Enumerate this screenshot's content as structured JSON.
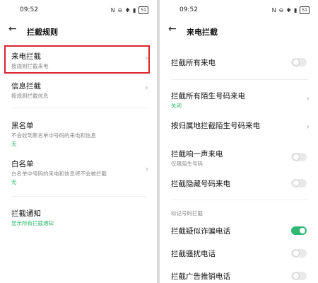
{
  "left": {
    "status": {
      "time": "09:52",
      "battery": "51"
    },
    "title": "拦截规则",
    "items": [
      {
        "label": "来电拦截",
        "sub": "按规则拦截来电"
      },
      {
        "label": "信息拦截",
        "sub": "按规则拦截信息"
      },
      {
        "label": "黑名单",
        "sub": "不会收到黑名单中号码的来电和信息",
        "value": "无"
      },
      {
        "label": "白名单",
        "sub": "白名单中号码的来电和信息将不会被拦截",
        "value": "无"
      },
      {
        "label": "拦截通知",
        "sub": "显示所有拦截通知"
      }
    ]
  },
  "right": {
    "status": {
      "time": "09:52",
      "battery": "51"
    },
    "title": "来电拦截",
    "items": [
      {
        "label": "拦截所有来电",
        "toggle_on": false
      },
      {
        "label": "拦截所有陌生号码来电",
        "sub": "关闭"
      },
      {
        "label": "按归属地拦截陌生号码来电"
      },
      {
        "label": "拦截响一声来电",
        "sub": "仅限陌生号码",
        "toggle_on": false
      },
      {
        "label": "拦截隐藏号码来电",
        "toggle_on": false
      }
    ],
    "section_label": "标记号码拦截",
    "marked_items": [
      {
        "label": "拦截疑似诈骗电话",
        "toggle_on": true
      },
      {
        "label": "拦截骚扰电话",
        "toggle_on": false
      },
      {
        "label": "拦截广告推销电话",
        "toggle_on": false
      }
    ]
  },
  "icons": {
    "back": "arrow-left-icon",
    "chevron": "chevron-right-icon"
  },
  "colors": {
    "accent_green": "#2eb872",
    "highlight_red": "#d9232b"
  }
}
